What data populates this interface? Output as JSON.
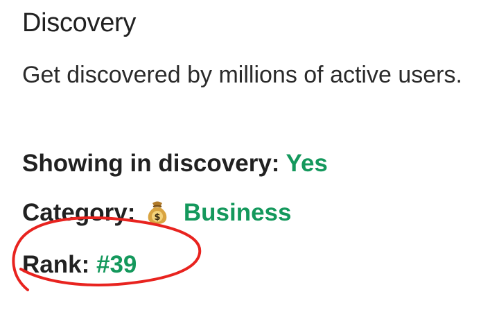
{
  "section": {
    "title": "Discovery",
    "description": "Get discovered by millions of active users."
  },
  "details": {
    "showing": {
      "label": "Showing in discovery:",
      "value": "Yes"
    },
    "category": {
      "label": "Category:",
      "icon": "money-bag-icon",
      "value": "Business"
    },
    "rank": {
      "label": "Rank:",
      "value": "#39"
    }
  },
  "colors": {
    "value_green": "#14985c",
    "annotation_red": "#e8231f",
    "text": "#212121"
  }
}
